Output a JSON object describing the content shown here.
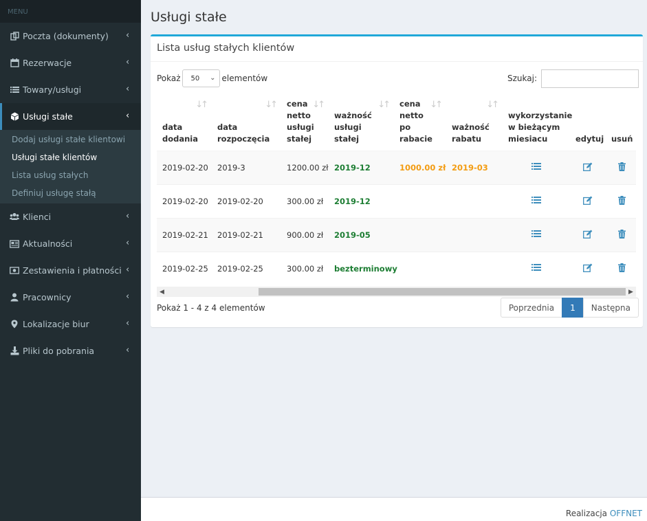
{
  "sidebar": {
    "header": "MENU",
    "items": [
      {
        "label": "Poczta (dokumenty)",
        "icon": "documents-icon"
      },
      {
        "label": "Rezerwacje",
        "icon": "calendar-icon"
      },
      {
        "label": "Towary/usługi",
        "icon": "list-icon"
      },
      {
        "label": "Usługi stałe",
        "icon": "cube-icon",
        "active": true
      },
      {
        "label": "Klienci",
        "icon": "users-icon"
      },
      {
        "label": "Aktualności",
        "icon": "newspaper-icon"
      },
      {
        "label": "Zestawienia i płatności",
        "icon": "money-icon"
      },
      {
        "label": "Pracownicy",
        "icon": "user-icon"
      },
      {
        "label": "Lokalizacje biur",
        "icon": "map-marker-icon"
      },
      {
        "label": "Pliki do pobrania",
        "icon": "download-icon"
      }
    ],
    "submenu": [
      {
        "label": "Dodaj usługi stałe klientowi"
      },
      {
        "label": "Usługi stałe klientów",
        "active": true
      },
      {
        "label": "Lista usług stałych"
      },
      {
        "label": "Definiuj usługę stałą"
      }
    ]
  },
  "page": {
    "title": "Usługi stałe",
    "box_title": "Lista usług stałych klientów"
  },
  "controls": {
    "show_label": "Pokaż",
    "length_value": "50",
    "elements_label": "elementów",
    "search_label": "Szukaj:",
    "search_value": ""
  },
  "table": {
    "columns": [
      [
        "data",
        "dodania"
      ],
      [
        "data",
        "rozpoczęcia"
      ],
      [
        "cena",
        "netto",
        "usługi",
        "stałej"
      ],
      [
        "ważność",
        "usługi",
        "stałej"
      ],
      [
        "cena",
        "netto",
        "po",
        "rabacie"
      ],
      [
        "ważność",
        "rabatu"
      ],
      [
        "wykorzystanie",
        "w bieżącym",
        "miesiacu"
      ],
      [
        "edytuj"
      ],
      [
        "usuń"
      ]
    ],
    "rows": [
      {
        "date_added": "2019-02-20",
        "date_start": "2019-3",
        "price": "1200.00 zł",
        "validity": "2019-12",
        "discount_price": "1000.00 zł",
        "discount_validity": "2019-03"
      },
      {
        "date_added": "2019-02-20",
        "date_start": "2019-02-20",
        "price": "300.00 zł",
        "validity": "2019-12",
        "discount_price": "",
        "discount_validity": ""
      },
      {
        "date_added": "2019-02-21",
        "date_start": "2019-02-21",
        "price": "900.00 zł",
        "validity": "2019-05",
        "discount_price": "",
        "discount_validity": ""
      },
      {
        "date_added": "2019-02-25",
        "date_start": "2019-02-25",
        "price": "300.00 zł",
        "validity": "bezterminowy",
        "discount_price": "",
        "discount_validity": ""
      }
    ]
  },
  "pagination": {
    "info": "Pokaż 1 - 4 z 4 elementów",
    "prev": "Poprzednia",
    "current": "1",
    "next": "Następna"
  },
  "footer": {
    "text": "Realizacja",
    "link": "OFFNET"
  },
  "colors": {
    "sidebar_bg": "#222d32",
    "accent": "#1fa8d8",
    "green": "#1e7e34",
    "orange": "#f39c12",
    "primary": "#337ab7"
  }
}
